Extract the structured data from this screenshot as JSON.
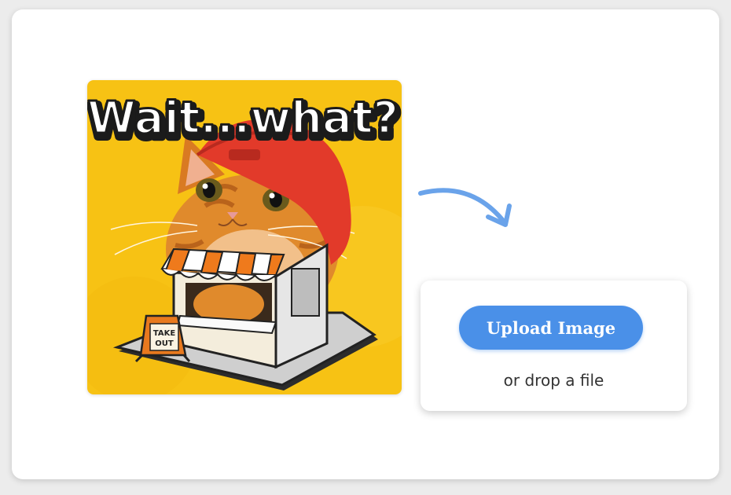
{
  "image": {
    "caption_text": "Wait...what?",
    "sign_line1": "TAKE",
    "sign_line2": "OUT"
  },
  "uploader": {
    "button_label": "Upload Image",
    "drop_text": "or drop a file"
  },
  "colors": {
    "accent": "#4a90e8",
    "arrow": "#6aa3ea",
    "image_background": "#f7c214"
  }
}
